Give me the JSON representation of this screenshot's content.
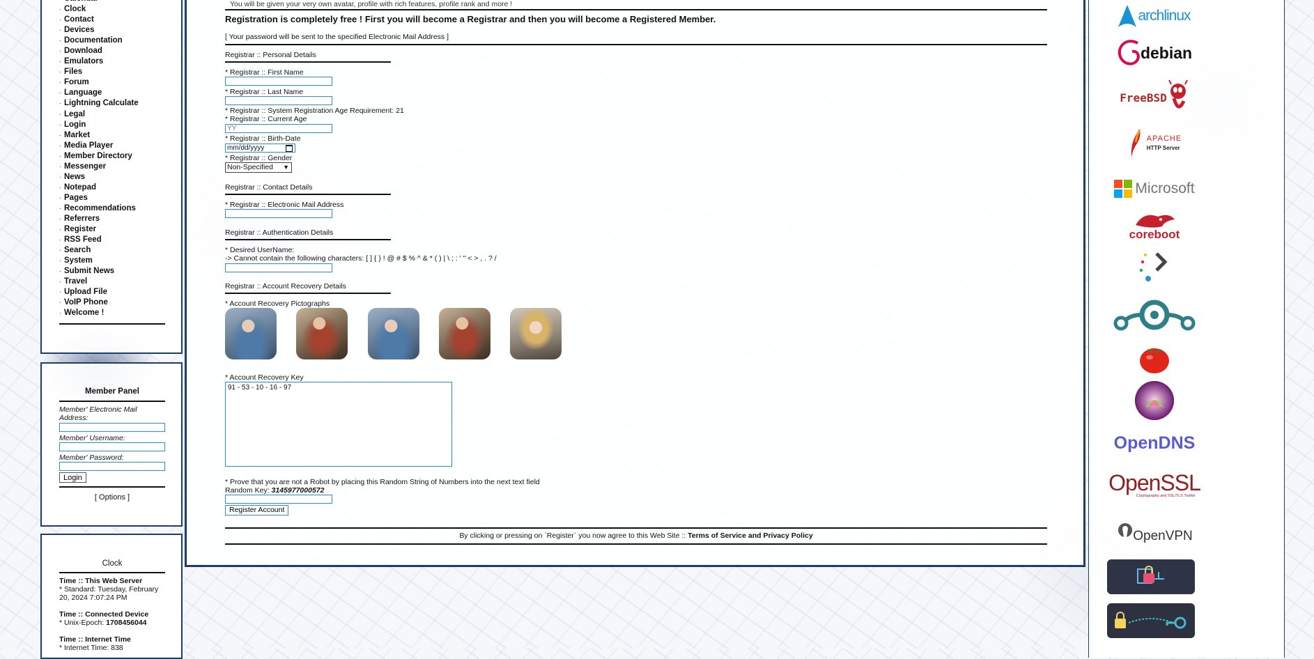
{
  "nav": {
    "items": [
      "Calendar",
      "Clock",
      "Contact",
      "Devices",
      "Documentation",
      "Download",
      "Emulators",
      "Files",
      "Forum",
      "Language",
      "Lightning Calculate",
      "Legal",
      "Login",
      "Market",
      "Media Player",
      "Member Directory",
      "Messenger",
      "News",
      "Notepad",
      "Pages",
      "Recommendations",
      "Referrers",
      "Register",
      "RSS Feed",
      "Search",
      "System",
      "Submit News",
      "Travel",
      "Upload File",
      "VoIP Phone",
      "Welcome !"
    ]
  },
  "member_panel": {
    "title": "Member Panel",
    "email_label": "Member' Electronic Mail Address:",
    "username_label": "Member' Username:",
    "password_label": "Member' Password:",
    "login_button": "Login",
    "options_link": "[ Options ]"
  },
  "clock": {
    "title": "Clock",
    "server_heading": "Time :: This Web Server",
    "server_standard": "* Standard: Tuesday, February 20, 2024 7:07:24 PM",
    "device_heading": "Time :: Connected Device",
    "unix_label": "* Unix-Epoch: ",
    "unix_value": "1708456044",
    "internet_heading": "Time :: Internet Time",
    "internet_value": "* Internet Time: 838"
  },
  "register": {
    "top_cut": "You will be given your very own avatar, profile with rich features, profile rank and more !",
    "headline": "Registration is completely free ! First you will become a Registrar and then you will become a Registered Member.",
    "password_note": "[ Your password will be sent to the specified Electronic Mail Address ]",
    "personal_head": "Registrar :: Personal Details",
    "first_name": "* Registrar :: First Name",
    "last_name": "* Registrar :: Last Name",
    "age_req": "* Registrar :: System Registration Age Requirement: 21",
    "current_age": "* Registrar :: Current Age",
    "current_age_placeholder": "YY",
    "birth_date": "* Registrar :: Birth-Date",
    "birth_placeholder": "mm/dd/yyyy",
    "gender": "* Registrar :: Gender",
    "gender_value": "Non-Specified",
    "contact_head": "Registrar :: Contact Details",
    "email_label": "* Registrar :: Electronic Mail Address",
    "auth_head": "Registrar :: Authentication Details",
    "username_label": "* Desired UserName:",
    "username_rule": "-> Cannot contain the following characters: [ ] { } ! @ # $ % ^ & * ( ) | \\ ; : ' \" < > , . ? /",
    "recovery_head": "Registrar :: Account Recovery Details",
    "pictographs_label": "* Account Recovery Pictographs",
    "recovery_key_label": "* Account Recovery Key",
    "recovery_key_value": "91 - 53 - 10 - 16 - 97",
    "robot_label": "* Prove that you are not a Robot by placing this Random String of Numbers into the next text field",
    "random_key_label": "Random Key: ",
    "random_key_value": "3145977000572",
    "submit_button": "Register Account",
    "agree_prefix": "By clicking or pressing on `Register` you now agree to this Web Site :: ",
    "agree_link": "Terms of Service and Privacy Policy"
  },
  "logos": {
    "arch": "archlinux",
    "debian": "debian",
    "freebsd": "FreeBSD",
    "apache_top": "APACHE",
    "apache_bottom": "HTTP Server",
    "microsoft": "Microsoft",
    "coreboot": "coreboot",
    "opendns": "OpenDNS",
    "openssl": "OpenSSL",
    "openssl_sub": "Cryptography and SSL/TLS Toolkit",
    "openvpn": "OpenVPN"
  },
  "colors": {
    "panel_border": "#1c3d66",
    "input_border": "#2b8fd1"
  }
}
